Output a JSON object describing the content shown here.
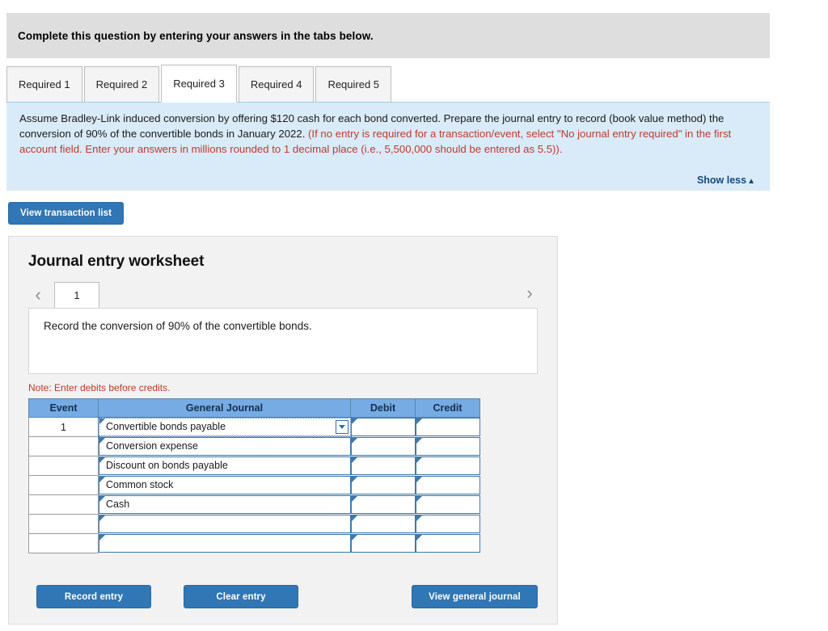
{
  "banner": {
    "text": "Complete this question by entering your answers in the tabs below."
  },
  "tabs": [
    {
      "label": "Required 1",
      "active": false
    },
    {
      "label": "Required 2",
      "active": false
    },
    {
      "label": "Required 3",
      "active": true
    },
    {
      "label": "Required 4",
      "active": false
    },
    {
      "label": "Required 5",
      "active": false
    }
  ],
  "instruction": {
    "black_part_1": "Assume Bradley-Link induced conversion by offering $120 cash for each bond converted. Prepare the journal entry to record (book value method) the conversion of 90% of the convertible bonds in January 2022. ",
    "red_part": "(If no entry is required for a transaction/event, select \"No journal entry required\" in the first account field. Enter your answers in millions rounded to 1 decimal place (i.e., 5,500,000 should be entered as 5.5)).",
    "show_less_label": "Show less",
    "show_less_caret": "▲"
  },
  "toolbar": {
    "view_transaction_list_label": "View transaction list"
  },
  "worksheet": {
    "title": "Journal entry worksheet",
    "pager": {
      "prev_icon": "‹",
      "next_icon": "›",
      "current_page": "1"
    },
    "record_description": "Record the conversion of 90% of the convertible bonds.",
    "note": "Note: Enter debits before credits.",
    "table": {
      "columns": [
        "Event",
        "General Journal",
        "Debit",
        "Credit"
      ],
      "rows": [
        {
          "event": "1",
          "account": "Convertible bonds payable",
          "debit": "",
          "credit": "",
          "focused": true,
          "dropdown": true
        },
        {
          "event": "",
          "account": "Conversion expense",
          "debit": "",
          "credit": "",
          "focused": false,
          "dropdown": false
        },
        {
          "event": "",
          "account": "Discount on bonds payable",
          "debit": "",
          "credit": "",
          "focused": false,
          "dropdown": false
        },
        {
          "event": "",
          "account": "Common stock",
          "debit": "",
          "credit": "",
          "focused": false,
          "dropdown": false
        },
        {
          "event": "",
          "account": "Cash",
          "debit": "",
          "credit": "",
          "focused": false,
          "dropdown": false
        },
        {
          "event": "",
          "account": "",
          "debit": "",
          "credit": "",
          "focused": false,
          "dropdown": false
        },
        {
          "event": "",
          "account": "",
          "debit": "",
          "credit": "",
          "focused": false,
          "dropdown": false
        }
      ]
    },
    "buttons": {
      "record_entry": "Record entry",
      "clear_entry": "Clear entry",
      "view_general_journal": "View general journal"
    }
  },
  "colors": {
    "banner_gray": "#dedede",
    "instruction_blue": "#d9ebf8",
    "accent_blue": "#3176b5",
    "table_header_blue": "#76abe4",
    "alert_red": "#c0392b",
    "link_blue": "#15487e",
    "field_border": "#3f78ad"
  }
}
